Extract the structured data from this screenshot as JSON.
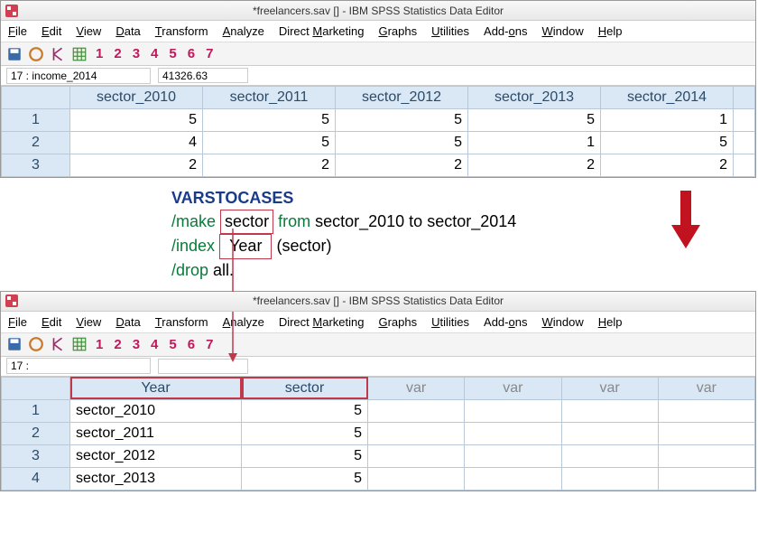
{
  "win1": {
    "title": "*freelancers.sav [] - IBM SPSS Statistics Data Editor",
    "menu": {
      "file": "File",
      "edit": "Edit",
      "view": "View",
      "data": "Data",
      "transform": "Transform",
      "analyze": "Analyze",
      "dm": "Direct Marketing",
      "graphs": "Graphs",
      "utilities": "Utilities",
      "addons": "Add-ons",
      "window": "Window",
      "help": "Help"
    },
    "nums": [
      "1",
      "2",
      "3",
      "4",
      "5",
      "6",
      "7"
    ],
    "cellref": {
      "name": "17 : income_2014",
      "val": "41326.63"
    },
    "cols": [
      "sector_2010",
      "sector_2011",
      "sector_2012",
      "sector_2013",
      "sector_2014"
    ],
    "rows": [
      {
        "n": "1",
        "v": [
          "5",
          "5",
          "5",
          "5",
          "1"
        ]
      },
      {
        "n": "2",
        "v": [
          "4",
          "5",
          "5",
          "1",
          "5"
        ]
      },
      {
        "n": "3",
        "v": [
          "2",
          "2",
          "2",
          "2",
          "2"
        ]
      }
    ]
  },
  "syntax": {
    "cmd": "VARSTOCASES",
    "make": "/make",
    "sector": "sector",
    "from": "from",
    "from_spec": "sector_2010 to sector_2014",
    "index": "/index",
    "year": "Year",
    "idx_spec": "(sector)",
    "drop": "/drop",
    "drop_spec": "all."
  },
  "win2": {
    "title": "*freelancers.sav [] - IBM SPSS Statistics Data Editor",
    "menu": {
      "file": "File",
      "edit": "Edit",
      "view": "View",
      "data": "Data",
      "transform": "Transform",
      "analyze": "Analyze",
      "dm": "Direct Marketing",
      "graphs": "Graphs",
      "utilities": "Utilities",
      "addons": "Add-ons",
      "window": "Window",
      "help": "Help"
    },
    "nums": [
      "1",
      "2",
      "3",
      "4",
      "5",
      "6",
      "7"
    ],
    "cellref": {
      "name": "17 :",
      "val": ""
    },
    "cols": [
      "Year",
      "sector",
      "var",
      "var",
      "var",
      "var"
    ],
    "rows": [
      {
        "n": "1",
        "y": "sector_2010",
        "s": "5"
      },
      {
        "n": "2",
        "y": "sector_2011",
        "s": "5"
      },
      {
        "n": "3",
        "y": "sector_2012",
        "s": "5"
      },
      {
        "n": "4",
        "y": "sector_2013",
        "s": "5"
      }
    ]
  }
}
